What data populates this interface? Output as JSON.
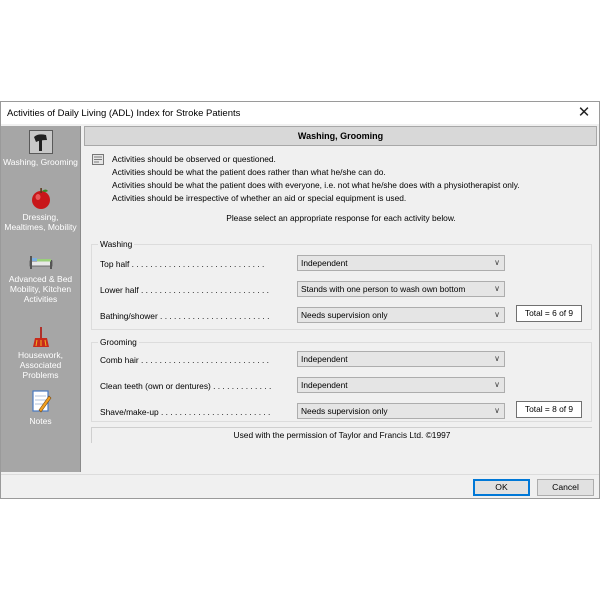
{
  "window": {
    "title": "Activities of Daily Living (ADL) Index for Stroke Patients",
    "close_glyph": "✕"
  },
  "sidebar": {
    "items": [
      {
        "label": "Washing, Grooming",
        "icon": "hairdryer-icon",
        "active": true
      },
      {
        "label": "Dressing, Mealtimes, Mobility",
        "icon": "apple-icon"
      },
      {
        "label": "Advanced & Bed Mobility, Kitchen Activities",
        "icon": "bed-icon"
      },
      {
        "label": "Housework, Associated Problems",
        "icon": "broom-icon"
      },
      {
        "label": "Notes",
        "icon": "notepad-icon"
      }
    ]
  },
  "header": {
    "title": "Washing, Grooming"
  },
  "info": {
    "lines": [
      "Activities should be observed or questioned.",
      "Activities should be what the patient does rather than what he/she can do.",
      "Activities should be what the patient does with everyone, i.e. not what he/she does with a physiotherapist only.",
      "Activities should be irrespective of whether an aid or special equipment is used."
    ],
    "prompt": "Please select an appropriate response for each activity below."
  },
  "washing": {
    "title": "Washing",
    "rows": [
      {
        "label": "Top half . . . . . . . . . . . . . . . . . . . . . . . . . . . . .",
        "value": "Independent"
      },
      {
        "label": "Lower half . . . . . . . . . . . . . . . . . . . . . . . . . . . .",
        "value": "Stands with one person to wash own bottom"
      },
      {
        "label": "Bathing/shower . . . . . . . . . . . . . . . . . . . . . . . .",
        "value": "Needs supervision only"
      }
    ],
    "total": "Total = 6 of 9"
  },
  "grooming": {
    "title": "Grooming",
    "rows": [
      {
        "label": "Comb hair . . . . . . . . . . . . . . . . . . . . . . . . . . . .",
        "value": "Independent"
      },
      {
        "label": "Clean teeth (own or dentures) . . . . . . . . . . . . .",
        "value": "Independent"
      },
      {
        "label": "Shave/make-up . . . . . . . . . . . . . . . . . . . . . . . .",
        "value": "Needs supervision only"
      }
    ],
    "total": "Total = 8 of 9"
  },
  "footer": {
    "permission": "Used with the permission of Taylor and Francis Ltd.  ©1997"
  },
  "buttons": {
    "ok": "OK",
    "cancel": "Cancel"
  }
}
